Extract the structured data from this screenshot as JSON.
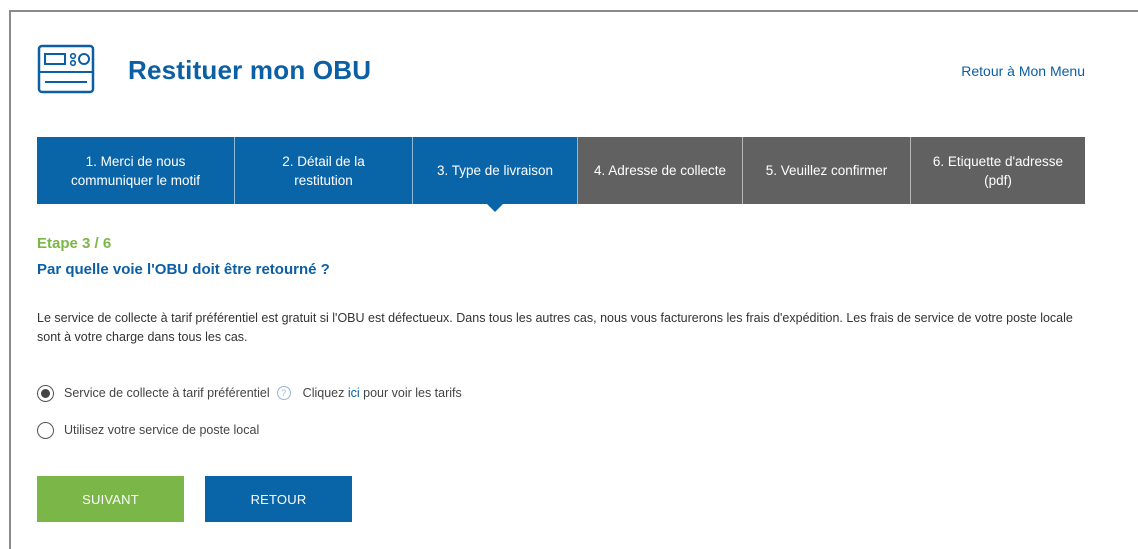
{
  "header": {
    "title": "Restituer mon OBU",
    "back_link": "Retour à Mon Menu",
    "icon": "obu-device-icon"
  },
  "stepper": {
    "steps": [
      {
        "label": "1. Merci de nous communiquer le motif",
        "state": "done"
      },
      {
        "label": "2. Détail de la restitution",
        "state": "done"
      },
      {
        "label": "3. Type de livraison",
        "state": "active"
      },
      {
        "label": "4. Adresse de collecte",
        "state": "pending"
      },
      {
        "label": "5. Veuillez confirmer",
        "state": "pending"
      },
      {
        "label": "6. Etiquette d'adresse (pdf)",
        "state": "pending"
      }
    ]
  },
  "content": {
    "step_counter": "Etape 3 / 6",
    "question": "Par quelle voie l'OBU doit être retourné ?",
    "info": "Le service de collecte à tarif préférentiel est gratuit si l'OBU est défectueux. Dans tous les autres cas, nous vous facturerons les frais d'expédition. Les frais de service de votre poste locale sont à votre charge dans tous les cas.",
    "options": [
      {
        "label": "Service de collecte à tarif préférentiel",
        "checked": true
      },
      {
        "label": "Utilisez votre service de poste local",
        "checked": false
      }
    ],
    "tariff_prefix": "Cliquez ",
    "tariff_link": "ici",
    "tariff_suffix": " pour voir les tarifs"
  },
  "buttons": {
    "next": "SUIVANT",
    "back": "RETOUR"
  },
  "colors": {
    "brand_blue": "#0a65a8",
    "step_gray": "#616161",
    "green": "#7ab648"
  }
}
